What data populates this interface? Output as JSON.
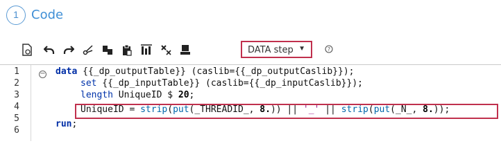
{
  "step": {
    "number": "1",
    "title": "Code"
  },
  "toolbar": {
    "icons": [
      "run-icon",
      "undo-icon",
      "redo-icon",
      "cut-icon",
      "copy-icon",
      "paste-icon",
      "insert-icon",
      "clear-icon",
      "format-icon"
    ],
    "dropdown_value": "DATA step",
    "help_icon": "help-icon"
  },
  "editor": {
    "line_numbers": [
      "1",
      "2",
      "3",
      "4",
      "5",
      "6"
    ],
    "lines": [
      "data {{_dp_outputTable}} (caslib={{_dp_outputCaslib}});",
      "set {{_dp_inputTable}} (caslib={{_dp_inputCaslib}});",
      "length UniqueID $ 20;",
      "UniqueID = strip(put(_THREADID_, 8.)) || '_' || strip(put(_N_, 8.));",
      "run;",
      ""
    ]
  },
  "colors": {
    "accent": "#3f8fd6",
    "highlight_border": "#c0304d"
  }
}
